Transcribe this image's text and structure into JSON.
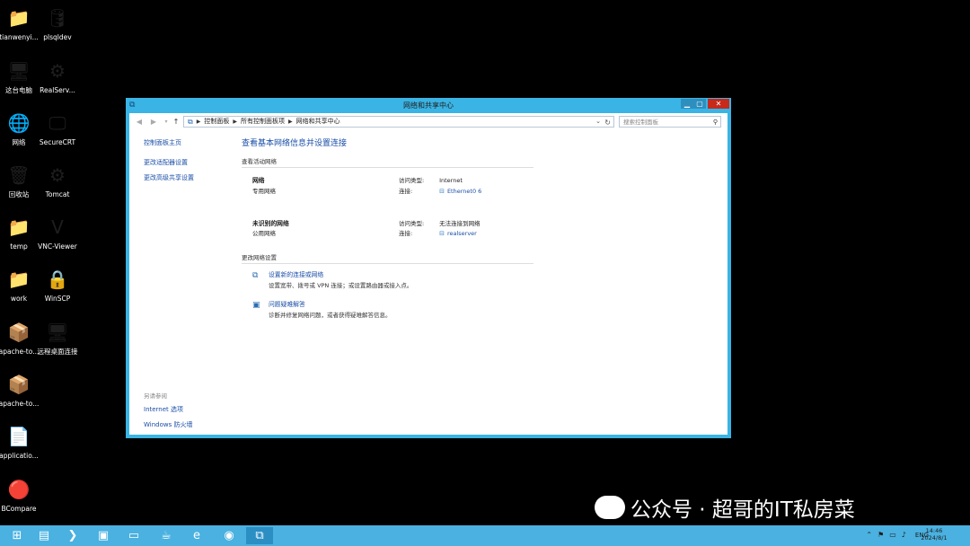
{
  "desktop": {
    "icons_left": [
      {
        "label": "tianwenyi...",
        "icon": "folder-user-icon",
        "glyph": "📁"
      },
      {
        "label": "这台电脑",
        "icon": "computer-icon",
        "glyph": "🖥"
      },
      {
        "label": "网络",
        "icon": "network-icon",
        "glyph": "🌐"
      },
      {
        "label": "回收站",
        "icon": "recycle-bin-icon",
        "glyph": "🗑"
      },
      {
        "label": "temp",
        "icon": "folder-icon",
        "glyph": "📁"
      },
      {
        "label": "work",
        "icon": "folder-icon",
        "glyph": "📁"
      },
      {
        "label": "apache-to...",
        "icon": "archive-icon",
        "glyph": "📦"
      },
      {
        "label": "apache-to...",
        "icon": "archive-icon",
        "glyph": "📦"
      },
      {
        "label": "applicatio...",
        "icon": "document-icon",
        "glyph": "📄"
      },
      {
        "label": "BCompare",
        "icon": "bcompare-icon",
        "glyph": "🔴"
      }
    ],
    "icons_right": [
      {
        "label": "plsqldev",
        "icon": "database-icon",
        "glyph": "🛢"
      },
      {
        "label": "RealServ...",
        "icon": "settings-app-icon",
        "glyph": "⚙"
      },
      {
        "label": "SecureCRT",
        "icon": "terminal-icon",
        "glyph": "🖵"
      },
      {
        "label": "Tomcat",
        "icon": "settings-app-icon",
        "glyph": "⚙"
      },
      {
        "label": "VNC-Viewer",
        "icon": "vnc-icon",
        "glyph": "V"
      },
      {
        "label": "WinSCP",
        "icon": "winscp-icon",
        "glyph": "🔒"
      },
      {
        "label": "远程桌面连接",
        "icon": "remote-desktop-icon",
        "glyph": "🖥"
      }
    ]
  },
  "window": {
    "title": "网络和共享中心",
    "address": {
      "crumbs": [
        "控制面板",
        "所有控制面板项",
        "网络和共享中心"
      ]
    },
    "search_placeholder": "搜索控制面板"
  },
  "left_nav": {
    "items": [
      "控制面板主页",
      "更改适配器设置",
      "更改高级共享设置"
    ],
    "see_also_header": "另请参阅",
    "see_also": [
      "Internet 选项",
      "Windows 防火墙"
    ]
  },
  "main": {
    "heading": "查看基本网络信息并设置连接",
    "active_header": "查看活动网络",
    "networks": [
      {
        "name": "网络",
        "type": "专用网络",
        "access_label": "访问类型:",
        "access_value": "Internet",
        "conn_label": "连接:",
        "conn_value": "Ethernet0 6"
      },
      {
        "name": "未识别的网络",
        "type": "公用网络",
        "access_label": "访问类型:",
        "access_value": "无法连接到网络",
        "conn_label": "连接:",
        "conn_value": "realserver"
      }
    ],
    "change_header": "更改网络设置",
    "settings": [
      {
        "link": "设置新的连接或网络",
        "desc": "设置宽带、拨号或 VPN 连接；或设置路由器或接入点。"
      },
      {
        "link": "问题疑难解答",
        "desc": "诊断并修复网络问题，或者获得疑难解答信息。"
      }
    ]
  },
  "taskbar": {
    "tray_lang": "ENG",
    "time": "14:46",
    "date": "2024/8/1"
  },
  "watermark": "公众号 · 超哥的IT私房菜"
}
